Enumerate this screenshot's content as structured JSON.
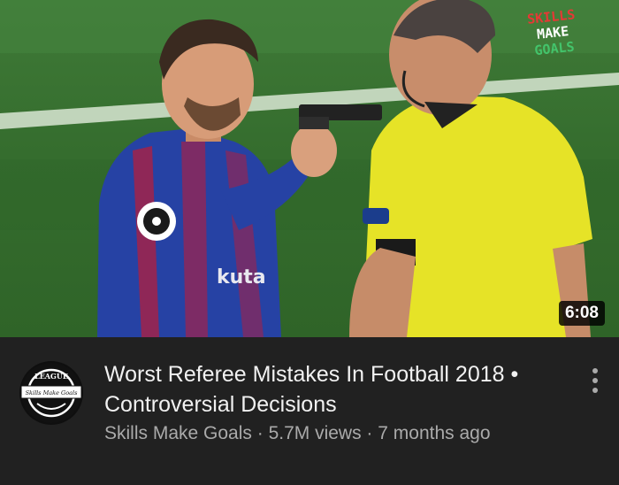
{
  "video": {
    "duration": "6:08",
    "watermark": {
      "line1": "SKILLS",
      "line2": "MAKE",
      "line3": "GOALS"
    },
    "jersey_text": "kuta",
    "title": "Worst Referee Mistakes In Football 2018 • Controversial Decisions",
    "channel": "Skills Make Goals",
    "views": "5.7M views",
    "age": "7 months ago",
    "separator": " · "
  },
  "channel_avatar": {
    "top_text": "LEAGUE",
    "banner_text": "Skills Make Goals"
  },
  "colors": {
    "background": "#212121",
    "title_text": "#f1f1f1",
    "meta_text": "#aaaaaa",
    "pitch": "#3a7332",
    "player_shirt": "#1f3fa0",
    "referee_shirt": "#e6e327"
  },
  "icons": {
    "more": "vertical-ellipsis-icon"
  }
}
